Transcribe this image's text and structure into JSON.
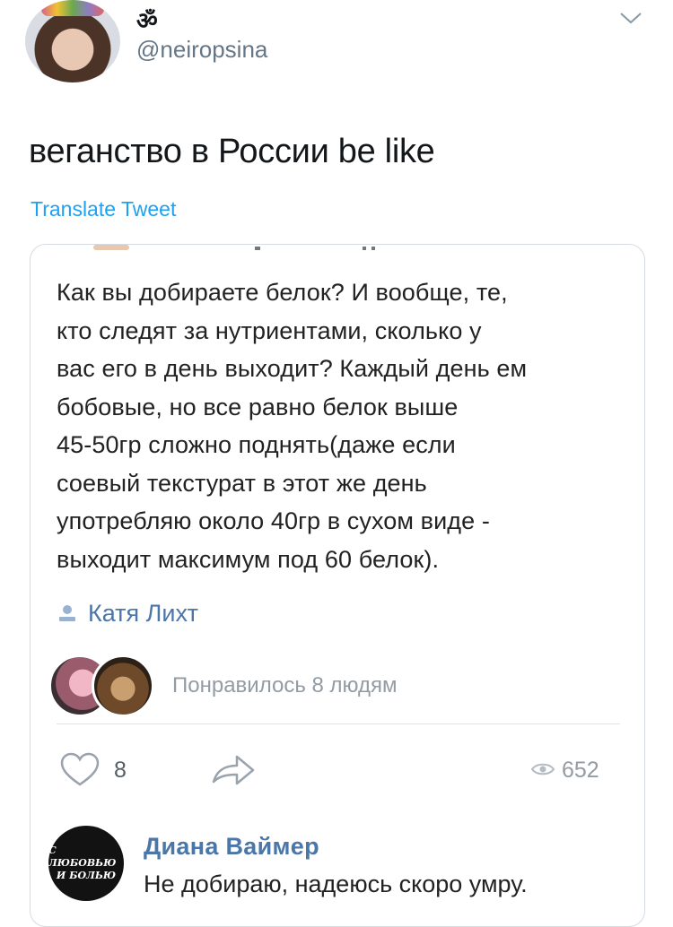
{
  "tweet": {
    "display_name": "ॐ",
    "handle": "@neiropsina",
    "text": "веганство в России be like",
    "translate_label": "Translate Tweet"
  },
  "post": {
    "body": "Как вы добираете белок? И вообще, те,\nкто следят за нутриентами, сколько у\nвас его в день выходит? Каждый день ем\nбобовые, но все равно белок выше\n45-50гр сложно поднять(даже если\nсоевый текстурат в этот же день\nупотребляю около 40гр в сухом виде -\nвыходит максимум под 60 белок).",
    "author": "Катя Лихт",
    "liked_text": "Понравилось 8 людям",
    "like_count": "8",
    "view_count": "652"
  },
  "comment": {
    "avatar_text_1": "С ЛЮБОВЬЮ",
    "avatar_text_2": "И БОЛЬЮ",
    "author": "Диана Ваймер",
    "text": "Не добираю, надеюсь скоро умру."
  },
  "colors": {
    "link_blue": "#1da1f2",
    "vk_blue": "#4a76a8",
    "muted": "#939ba3"
  },
  "icons": [
    "caret-down-icon",
    "person-icon",
    "heart-icon",
    "share-icon",
    "eye-icon"
  ]
}
